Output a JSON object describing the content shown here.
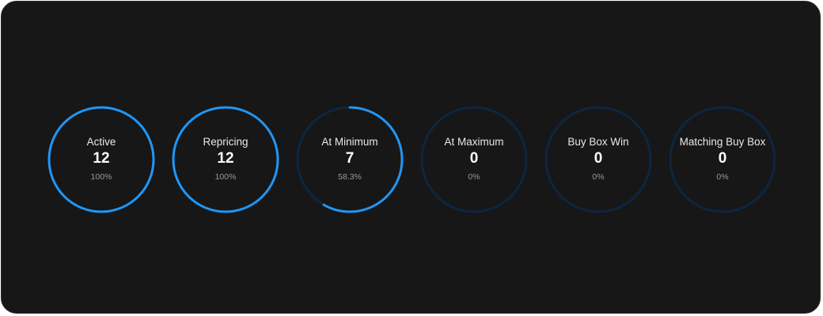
{
  "colors": {
    "background": "#171717",
    "ring_fill": "#2196f3",
    "ring_track": "#0d2640",
    "label": "#e8e8e8",
    "value": "#ffffff",
    "percent": "#9a9a9a"
  },
  "metrics": [
    {
      "label": "Active",
      "value": "12",
      "percent": "100%",
      "fraction": 1.0
    },
    {
      "label": "Repricing",
      "value": "12",
      "percent": "100%",
      "fraction": 1.0
    },
    {
      "label": "At Minimum",
      "value": "7",
      "percent": "58.3%",
      "fraction": 0.583
    },
    {
      "label": "At Maximum",
      "value": "0",
      "percent": "0%",
      "fraction": 0
    },
    {
      "label": "Buy Box Win",
      "value": "0",
      "percent": "0%",
      "fraction": 0
    },
    {
      "label": "Matching Buy Box",
      "value": "0",
      "percent": "0%",
      "fraction": 0
    }
  ]
}
